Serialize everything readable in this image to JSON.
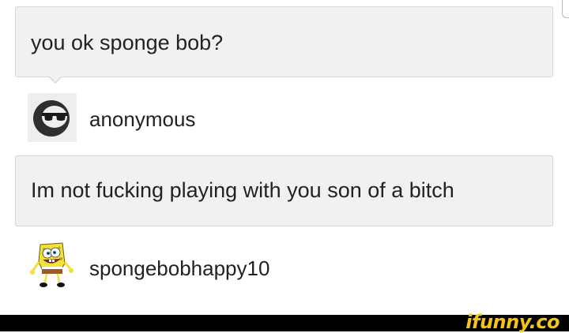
{
  "question": {
    "text": "you ok sponge bob?",
    "author": {
      "name": "anonymous",
      "avatar_icon": "anonymous-sunglasses-avatar-icon"
    }
  },
  "answer": {
    "text": "Im not fucking playing with you son of a bitch",
    "author": {
      "name": "spongebobhappy10",
      "avatar_icon": "spongebob-avatar-icon"
    }
  },
  "watermark": {
    "text": "ifunny.co",
    "color": "#f6c414"
  },
  "colors": {
    "bubble_bg": "#f1f1f1",
    "bubble_border": "#d6d6d6",
    "text": "#222222",
    "footer_bg": "#000000"
  }
}
